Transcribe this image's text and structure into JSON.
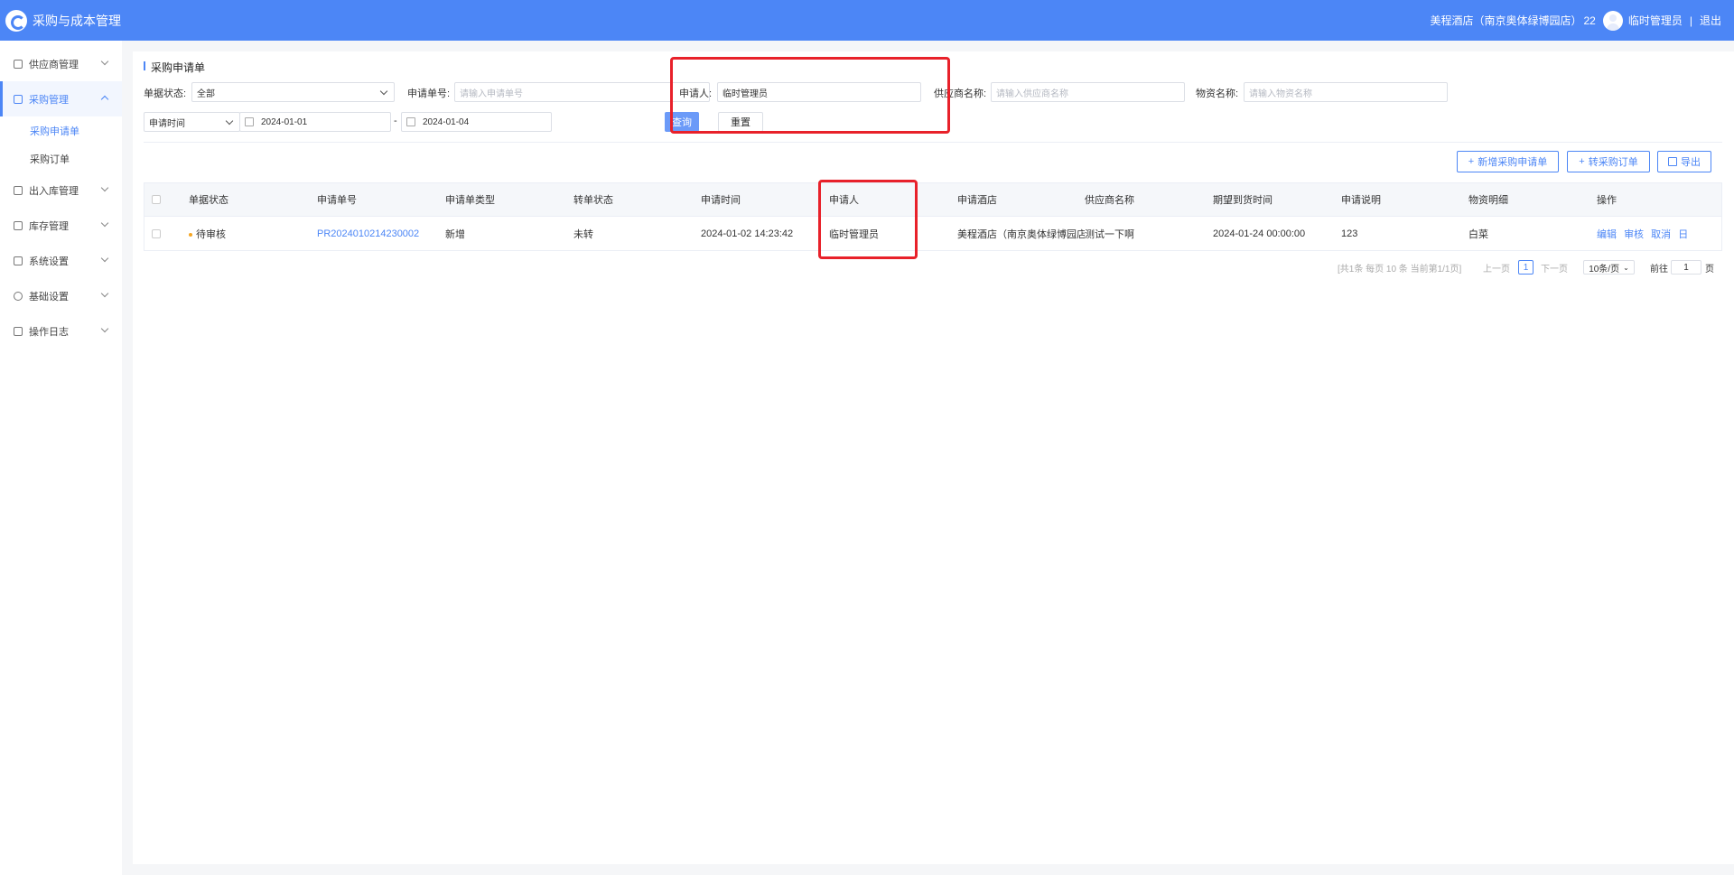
{
  "header": {
    "app_title": "采购与成本管理",
    "hotel": "美程酒店（南京奥体绿博园店）",
    "hotel_code": "22",
    "user": "临时管理员",
    "separator": "|",
    "logout": "退出"
  },
  "sidebar": {
    "items": [
      {
        "label": "供应商管理"
      },
      {
        "label": "采购管理"
      },
      {
        "label": "出入库管理"
      },
      {
        "label": "库存管理"
      },
      {
        "label": "系统设置"
      },
      {
        "label": "基础设置"
      },
      {
        "label": "操作日志"
      }
    ],
    "sub_items": [
      {
        "label": "采购申请单"
      },
      {
        "label": "采购订单"
      }
    ]
  },
  "page": {
    "title": "采购申请单"
  },
  "filters": {
    "status_label": "单据状态:",
    "status_value": "全部",
    "order_no_label": "申请单号:",
    "order_no_placeholder": "请输入申请单号",
    "applicant_label": "申请人:",
    "applicant_value": "临时管理员",
    "supplier_label": "供应商名称:",
    "supplier_placeholder": "请输入供应商名称",
    "material_label": "物资名称:",
    "material_placeholder": "请输入物资名称",
    "time_type": "申请时间",
    "date_start": "2024-01-01",
    "date_sep": "-",
    "date_end": "2024-01-04",
    "query_button": "查询",
    "reset_button": "重置"
  },
  "actions": {
    "add": "新增采购申请单",
    "convert": "转采购订单",
    "export": "导出"
  },
  "table": {
    "columns": [
      "单据状态",
      "申请单号",
      "申请单类型",
      "转单状态",
      "申请时间",
      "申请人",
      "申请酒店",
      "供应商名称",
      "期望到货时间",
      "申请说明",
      "物资明细",
      "操作"
    ],
    "rows": [
      {
        "status": "待审核",
        "order_no": "PR2024010214230002",
        "type": "新增",
        "convert_status": "未转",
        "apply_time": "2024-01-02 14:23:42",
        "applicant": "临时管理员",
        "hotel": "美程酒店（南京奥体绿博园店）",
        "supplier": "测试一下啊",
        "expected_time": "2024-01-24 00:00:00",
        "note": "123",
        "items": "白菜",
        "ops": [
          "编辑",
          "审核",
          "取消",
          "日志"
        ]
      }
    ]
  },
  "pagination": {
    "summary": "[共1条 每页 10 条 当前第1/1页]",
    "prev": "上一页",
    "current": "1",
    "next": "下一页",
    "page_size": "10条/页",
    "goto_label": "前往",
    "goto_value": "1",
    "goto_suffix": "页"
  },
  "colors": {
    "accent": "#4c86f6",
    "highlight": "#e8212a",
    "pending": "#f5a623"
  }
}
